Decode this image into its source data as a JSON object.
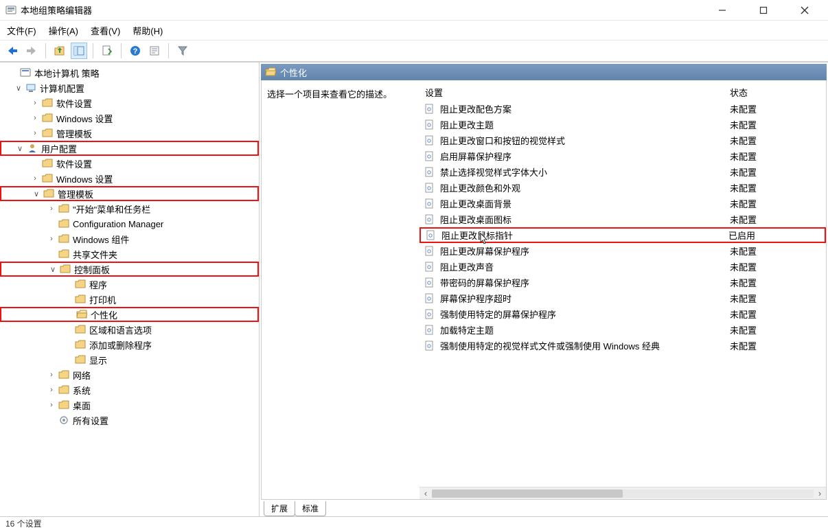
{
  "window": {
    "title": "本地组策略编辑器"
  },
  "menu": {
    "file": "文件(F)",
    "action": "操作(A)",
    "view": "查看(V)",
    "help": "帮助(H)"
  },
  "tree": {
    "root": "本地计算机 策略",
    "computer_config": "计算机配置",
    "software_settings": "软件设置",
    "windows_settings": "Windows 设置",
    "admin_templates": "管理模板",
    "user_config": "用户配置",
    "software_settings2": "软件设置",
    "windows_settings2": "Windows 设置",
    "admin_templates2": "管理模板",
    "start_taskbar": "\"开始\"菜单和任务栏",
    "config_manager": "Configuration Manager",
    "windows_components": "Windows 组件",
    "shared_folders": "共享文件夹",
    "control_panel": "控制面板",
    "programs": "程序",
    "printers": "打印机",
    "personalization": "个性化",
    "region_language": "区域和语言选项",
    "add_remove_programs": "添加或删除程序",
    "display": "显示",
    "network": "网络",
    "system": "系统",
    "desktop": "桌面",
    "all_settings": "所有设置"
  },
  "detail": {
    "header": "个性化",
    "description": "选择一个项目来查看它的描述。",
    "col_setting": "设置",
    "col_state": "状态",
    "state_not_configured": "未配置",
    "state_enabled": "已启用"
  },
  "settings": {
    "s0": "阻止更改配色方案",
    "s1": "阻止更改主题",
    "s2": "阻止更改窗口和按钮的视觉样式",
    "s3": "启用屏幕保护程序",
    "s4": "禁止选择视觉样式字体大小",
    "s5": "阻止更改颜色和外观",
    "s6": "阻止更改桌面背景",
    "s7": "阻止更改桌面图标",
    "s8": "阻止更改鼠标指针",
    "s9": "阻止更改屏幕保护程序",
    "s10": "阻止更改声音",
    "s11": "带密码的屏幕保护程序",
    "s12": "屏幕保护程序超时",
    "s13": "强制使用特定的屏幕保护程序",
    "s14": "加载特定主题",
    "s15": "强制使用特定的视觉样式文件或强制使用 Windows 经典"
  },
  "tabs": {
    "extended": "扩展",
    "standard": "标准"
  },
  "status": {
    "count": "16 个设置"
  }
}
